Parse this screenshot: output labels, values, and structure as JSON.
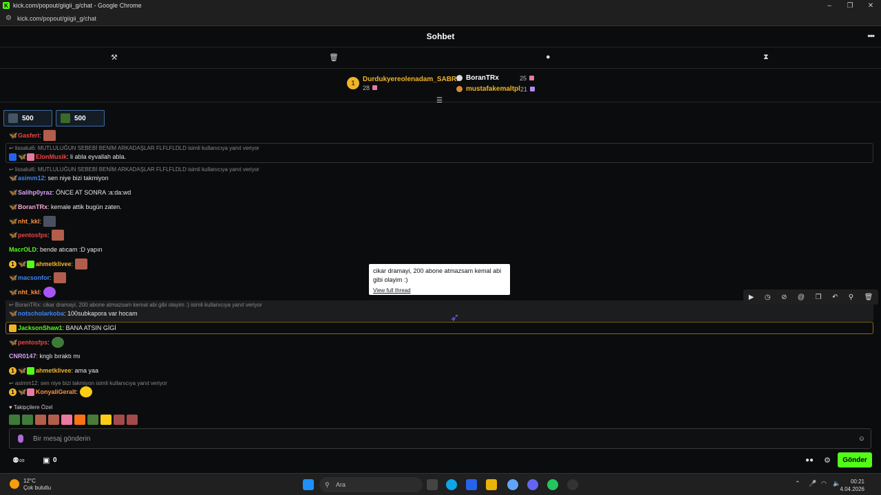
{
  "window": {
    "title": "kick.com/popout/giigii_g/chat - Google Chrome",
    "url": "kick.com/popout/giigii_g/chat"
  },
  "header": {
    "title": "Sohbet"
  },
  "leaderboard": {
    "top": {
      "rank": "1",
      "name": "Durdukyereolenadam_SABRI",
      "count": "28"
    },
    "second": {
      "name": "BoranTRx",
      "count": "25"
    },
    "third": {
      "name": "mustafakemaltpl",
      "count": "21"
    }
  },
  "pills": [
    {
      "value": "500"
    },
    {
      "value": "500"
    }
  ],
  "messages": {
    "m1": {
      "user": "Gasferi",
      "text": ""
    },
    "r1": "↩ lissalui6: MUTLULUĞUN SEBEBİ BENİM ARKADAŞLAR FLFLFLDLD isimli kullanıcıya yanıt veriyor",
    "m2": {
      "user": "ElonMusik",
      "text": ": li abla eyvallah abla."
    },
    "r2": "↩ lissalui6: MUTLULUĞUN SEBEBİ BENİM ARKADAŞLAR FLFLFLDLD isimli kullanıcıya yanıt veriyor",
    "m3": {
      "user": "asimm12",
      "text": ": sen niye bizi takmiyon"
    },
    "m4": {
      "user": "Salihp0yraz",
      "text": ": ÖNCE AT SONRA :a:da:wd"
    },
    "m5": {
      "user": "BoranTRx",
      "text": ": kemale attik bugün zaten."
    },
    "m6": {
      "user": "nht_kkl",
      "text": ":"
    },
    "m7": {
      "user": "pentosfps",
      "text": ":"
    },
    "m8": {
      "user": "MacrOLD",
      "text": ": bende atıcam :D yapın"
    },
    "m9": {
      "user": "ahmetklivee",
      "text": ":",
      "num": "1"
    },
    "m10": {
      "user": "macsonfor",
      "text": ":"
    },
    "m11": {
      "user": "nht_kkl",
      "text": ":"
    },
    "r3": "↩ BoranTRx: cikar dramayi, 200 abone atmazsam kemal abi gibi olayim :) isimli kullanıcıya yanıt veriyor",
    "m12": {
      "user": "notscholarkoba",
      "text": ": 100subkapora var hocam"
    },
    "m13": {
      "user": "JacksonShaw1",
      "text": ": BANA ATSIN GİGİ"
    },
    "m14": {
      "user": "pentosfps",
      "text": ":"
    },
    "m15": {
      "user": "CNR0147",
      "text": ": knglı bıraktı mı"
    },
    "m16": {
      "user": "ahmetklivee",
      "text": ": ama yaa",
      "num": "1"
    },
    "r4": "↩ asimm12: sen niye bizi takmiyon isimli kullanıcıya yanıt veriyor",
    "m17": {
      "user": "KonyaliGeralt",
      "text": ":",
      "num": "1"
    }
  },
  "tooltip": {
    "text": "cikar dramayi, 200 abone atmazsam kemal abi gibi olayim :)",
    "link": "View full thread"
  },
  "follower_section": {
    "label": "♥ Takipçilere Özel"
  },
  "input": {
    "placeholder": "Bir mesaj gönderin"
  },
  "footer": {
    "count": "0",
    "send_label": "Gönder"
  },
  "taskbar": {
    "temp": "12°C",
    "weather": "Çok bulutlu",
    "search": "Ara",
    "time": "00:21",
    "date": "4.04.2026"
  },
  "colors": {
    "accent": "#53fc18",
    "gold": "#f0b429"
  }
}
